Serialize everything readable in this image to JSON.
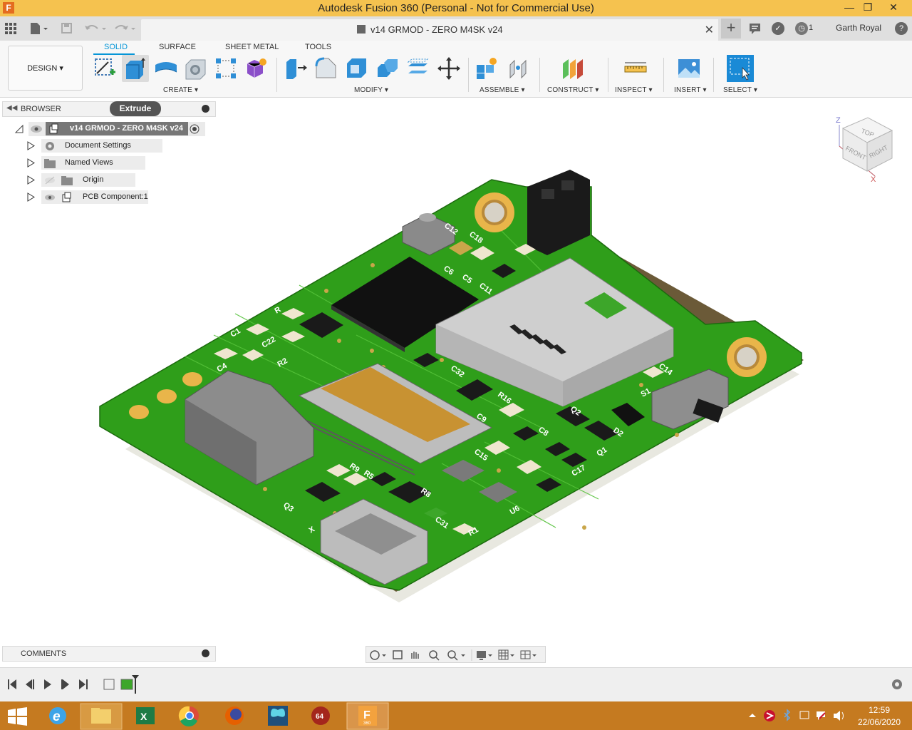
{
  "app": {
    "window_title": "Autodesk Fusion 360 (Personal - Not for Commercial Use)",
    "logo": "F",
    "window_controls": [
      "minimize-icon",
      "restore-icon",
      "close-icon"
    ]
  },
  "tabs": {
    "document_title": "v14 GRMOD - ZERO M4SK v24",
    "job_count": "1",
    "user_name": "Garth Royal"
  },
  "toolbar": {
    "workspace": "DESIGN",
    "workspace_tabs": [
      "SOLID",
      "SURFACE",
      "SHEET METAL",
      "TOOLS"
    ],
    "active_tab": "SOLID",
    "groups": {
      "create": "CREATE",
      "modify": "MODIFY",
      "assemble": "ASSEMBLE",
      "construct": "CONSTRUCT",
      "inspect": "INSPECT",
      "insert": "INSERT",
      "select": "SELECT"
    }
  },
  "browser": {
    "title": "BROWSER",
    "tooltip": "Extrude",
    "root": "v14 GRMOD - ZERO M4SK v24",
    "items": [
      "Document Settings",
      "Named Views",
      "Origin",
      "PCB Component:1"
    ]
  },
  "comments": {
    "title": "COMMENTS"
  },
  "viewcube": {
    "top": "TOP",
    "front": "FRONT",
    "right": "RIGHT",
    "axis_z": "Z",
    "axis_x": "X"
  },
  "pcb_labels": [
    "C12",
    "C18",
    "C6",
    "C5",
    "C11",
    "C1",
    "C22",
    "R2",
    "C4",
    "R",
    "C32",
    "R16",
    "C9",
    "C8",
    "Q2",
    "D2",
    "Q1",
    "C14",
    "S1",
    "C17",
    "C15",
    "R9",
    "R5",
    "R8",
    "Q3",
    "C31",
    "U6",
    "R1",
    "X"
  ],
  "taskbar": {
    "time": "12:59",
    "date": "22/06/2020",
    "apps": [
      "start-icon",
      "ie-icon",
      "explorer-icon",
      "excel-icon",
      "chrome-icon",
      "firefox-icon",
      "butterfly-app-icon",
      "app-64-icon",
      "fusion360-icon"
    ],
    "fusion_badge": "360",
    "app64_badge": "64"
  }
}
